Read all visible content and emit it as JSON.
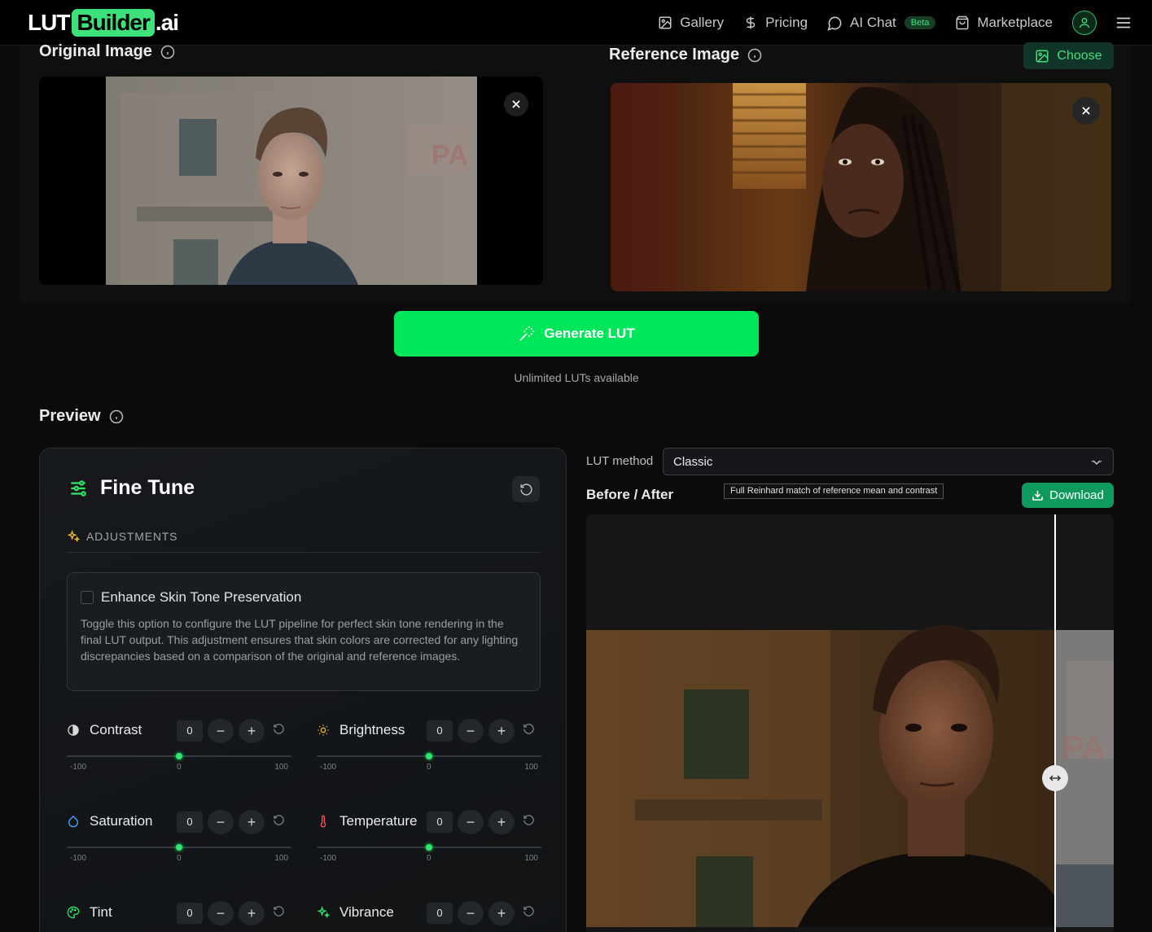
{
  "nav": {
    "logo": {
      "lut": "LUT",
      "builder": "Builder",
      "ai": ".ai"
    },
    "links": [
      {
        "label": "Gallery",
        "icon": "image-icon"
      },
      {
        "label": "Pricing",
        "icon": "dollar-icon"
      },
      {
        "label": "AI Chat",
        "icon": "chat-icon",
        "badge": "Beta"
      },
      {
        "label": "Marketplace",
        "icon": "shopping-bag-icon"
      }
    ],
    "icons": [
      "user-avatar-icon",
      "hamburger-menu-icon"
    ]
  },
  "original": {
    "title": "Original Image",
    "icon": "info-icon"
  },
  "reference": {
    "title": "Reference Image",
    "choose_label": "Choose",
    "icon": "info-icon"
  },
  "generate": {
    "label": "Generate LUT",
    "icon": "magic-wand-icon",
    "note": "Unlimited LUTs available"
  },
  "preview": {
    "title": "Preview"
  },
  "fine_tune": {
    "title": "Fine Tune",
    "adjustments_heading": "ADJUSTMENTS",
    "skin": {
      "label": "Enhance Skin Tone Preservation",
      "checked": false,
      "description": "Toggle this option to configure the LUT pipeline for perfect skin tone rendering in the final LUT output. This adjustment ensures that skin colors are corrected for any lighting discrepancies based on a comparison of the original and reference images."
    },
    "controls": [
      {
        "name": "Contrast",
        "value": "0",
        "min": "-100",
        "mid": "0",
        "max": "100",
        "fraction": 0.5,
        "icon": "contrast-icon",
        "color": "#d8d8d8"
      },
      {
        "name": "Brightness",
        "value": "0",
        "min": "-100",
        "mid": "0",
        "max": "100",
        "fraction": 0.5,
        "icon": "sun-icon",
        "color": "#f5b935"
      },
      {
        "name": "Saturation",
        "value": "0",
        "min": "-100",
        "mid": "0",
        "max": "100",
        "fraction": 0.5,
        "icon": "droplet-icon",
        "color": "#4aa3ff"
      },
      {
        "name": "Temperature",
        "value": "0",
        "min": "-100",
        "mid": "0",
        "max": "100",
        "fraction": 0.5,
        "icon": "thermometer-icon",
        "color": "#ff4d5e"
      },
      {
        "name": "Tint",
        "value": "0",
        "icon": "palette-icon",
        "color": "#2ee86a"
      },
      {
        "name": "Vibrance",
        "value": "0",
        "icon": "sparkle-icon",
        "color": "#2ee86a"
      }
    ]
  },
  "lut": {
    "method_label": "LUT method",
    "method_value": "Classic",
    "before_after_label": "Before / After",
    "tooltip": "Full Reinhard match of reference mean and contrast",
    "download_label": "Download",
    "split_fraction": 0.888
  },
  "colors": {
    "accent": "#00e65a",
    "logo_green": "#3ee27a",
    "download_green": "#0e9a5c"
  }
}
